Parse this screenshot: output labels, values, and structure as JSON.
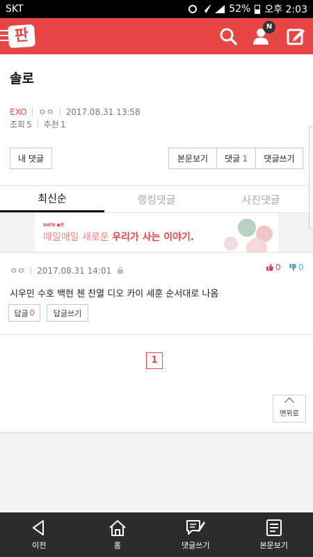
{
  "status_bar": {
    "carrier": "SKT",
    "battery": "52%",
    "time": "오후 2:03"
  },
  "header": {
    "logo": "판",
    "notification_badge": "N"
  },
  "post": {
    "title": "솔로",
    "category": "EXO",
    "author": "ㅇㅇ",
    "date": "2017.08.31 13:58",
    "views_label": "조회",
    "views": "5",
    "recommend_label": "추천",
    "recommend": "1"
  },
  "buttons": {
    "my_comments": "내 댓글",
    "view_body": "본문보기",
    "comments": "댓글",
    "comments_count": "1",
    "write_comment": "댓글쓰기"
  },
  "tabs": [
    {
      "label": "최신순",
      "active": true
    },
    {
      "label": "랭킹댓글",
      "active": false
    },
    {
      "label": "사진댓글",
      "active": false
    }
  ],
  "ad": {
    "brand": "NATE ●판",
    "text_prefix": "매일매일 새로운 ",
    "text_bold": "우리가 사는 이야기."
  },
  "comments": [
    {
      "author": "ㅇㅇ",
      "date": "2017.08.31 14:01",
      "text": "시우민 수호 백현 첸 찬열 디오 카이 세훈 순서대로 나옴",
      "likes": "0",
      "dislikes": "0",
      "reply_label": "답글",
      "reply_count": "0",
      "write_reply_label": "답글쓰기"
    }
  ],
  "pagination": {
    "current": "1"
  },
  "back_to_top": "맨위로",
  "bottom_nav": [
    {
      "label": "이전",
      "icon": "back-icon"
    },
    {
      "label": "홈",
      "icon": "home-icon"
    },
    {
      "label": "댓글쓰기",
      "icon": "comment-write-icon"
    },
    {
      "label": "본문보기",
      "icon": "document-icon"
    }
  ],
  "colors": {
    "brand": "#e84545",
    "bottom_bar": "#2c2c2c"
  }
}
